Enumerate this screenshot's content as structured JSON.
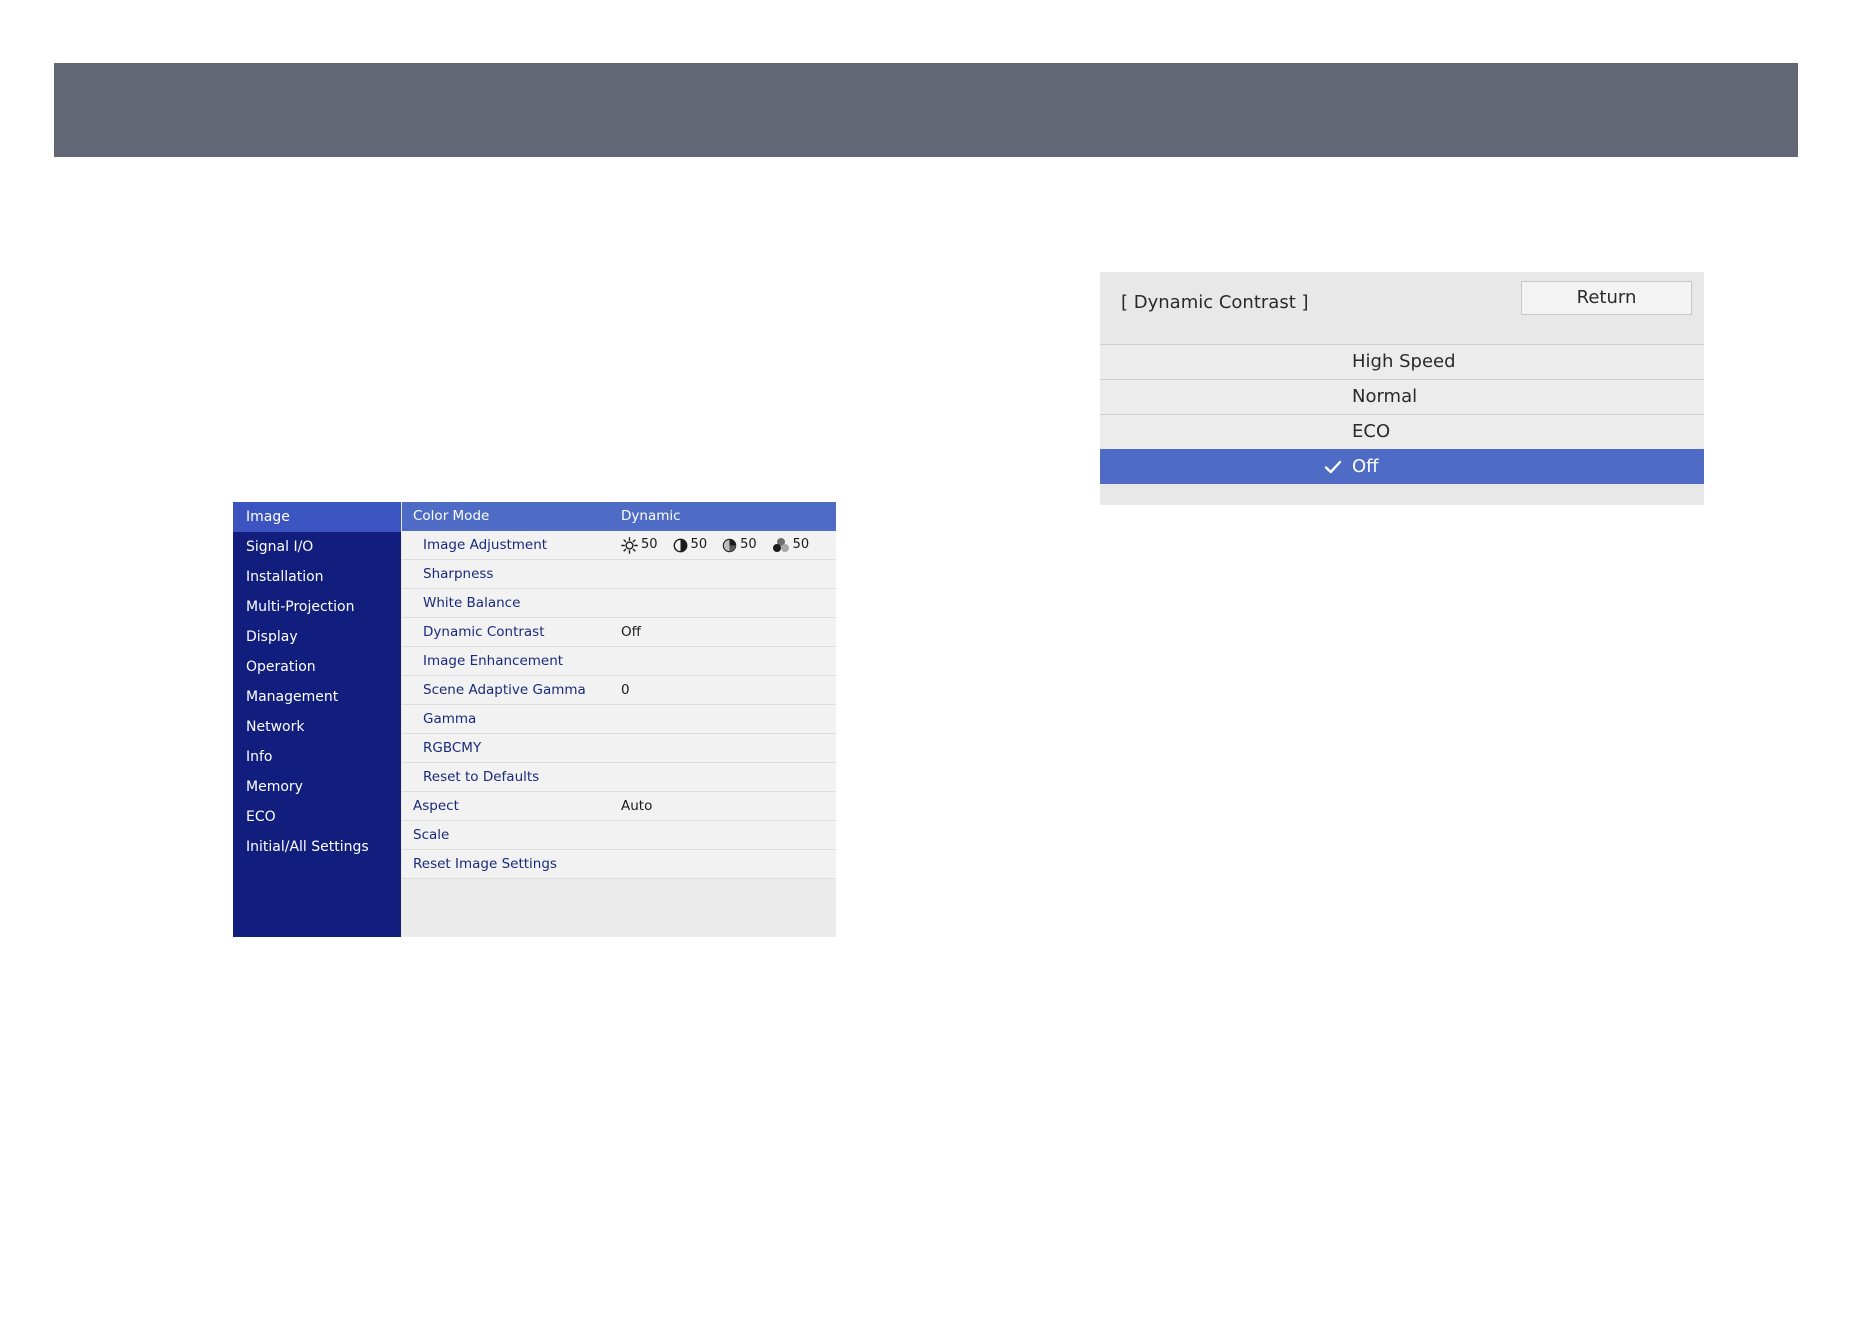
{
  "sidebar": {
    "items": [
      {
        "label": "Image"
      },
      {
        "label": "Signal I/O"
      },
      {
        "label": "Installation"
      },
      {
        "label": "Multi-Projection"
      },
      {
        "label": "Display"
      },
      {
        "label": "Operation"
      },
      {
        "label": "Management"
      },
      {
        "label": "Network"
      },
      {
        "label": "Info"
      },
      {
        "label": "Memory"
      },
      {
        "label": "ECO"
      },
      {
        "label": "Initial/All Settings"
      }
    ],
    "selected": "Image"
  },
  "menu": {
    "rows": [
      {
        "label": "Color Mode",
        "value": "Dynamic"
      },
      {
        "label": "Image Adjustment",
        "value": ""
      },
      {
        "label": "Sharpness",
        "value": ""
      },
      {
        "label": "White Balance",
        "value": ""
      },
      {
        "label": "Dynamic Contrast",
        "value": "Off"
      },
      {
        "label": "Image Enhancement",
        "value": ""
      },
      {
        "label": "Scene Adaptive Gamma",
        "value": "0"
      },
      {
        "label": "Gamma",
        "value": ""
      },
      {
        "label": "RGBCMY",
        "value": ""
      },
      {
        "label": "Reset to Defaults",
        "value": ""
      },
      {
        "label": "Aspect",
        "value": "Auto"
      },
      {
        "label": "Scale",
        "value": ""
      },
      {
        "label": "Reset Image Settings",
        "value": ""
      }
    ],
    "image_adjustment": {
      "brightness": "50",
      "contrast": "50",
      "color_saturation": "50",
      "tint": "50"
    }
  },
  "dialog": {
    "title": "[ Dynamic Contrast ]",
    "return_label": "Return",
    "options": [
      {
        "label": "High Speed"
      },
      {
        "label": "Normal"
      },
      {
        "label": "ECO"
      },
      {
        "label": "Off"
      }
    ],
    "selected": "Off"
  },
  "colors": {
    "header_bar": "#636674",
    "sidebar_bg": "#111e7e",
    "selection": "#4e6cc6"
  }
}
